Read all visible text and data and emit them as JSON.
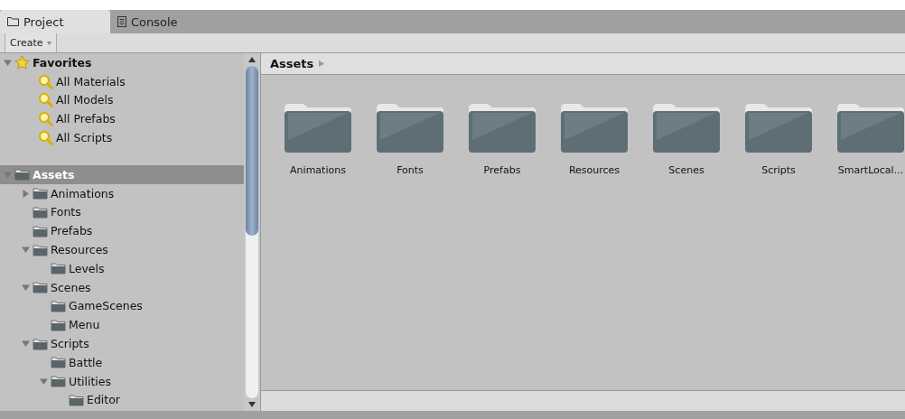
{
  "tabs": [
    {
      "label": "Project",
      "kind": "folder",
      "selected": true
    },
    {
      "label": "Console",
      "kind": "console",
      "selected": false
    }
  ],
  "toolbar": {
    "create_button": "Create"
  },
  "favorites": {
    "label": "Favorites",
    "expanded": true,
    "items": [
      {
        "label": "All Materials"
      },
      {
        "label": "All Models"
      },
      {
        "label": "All Prefabs"
      },
      {
        "label": "All Scripts"
      }
    ]
  },
  "tree": [
    {
      "label": "Assets",
      "expanded": true,
      "selected": true,
      "children": [
        {
          "label": "Animations",
          "expanded": false,
          "selected": false
        },
        {
          "label": "Fonts",
          "selected": false
        },
        {
          "label": "Prefabs",
          "selected": false
        },
        {
          "label": "Resources",
          "expanded": true,
          "selected": false,
          "children": [
            {
              "label": "Levels",
              "selected": false
            }
          ]
        },
        {
          "label": "Scenes",
          "expanded": true,
          "selected": false,
          "children": [
            {
              "label": "GameScenes",
              "selected": false
            },
            {
              "label": "Menu",
              "selected": false
            }
          ]
        },
        {
          "label": "Scripts",
          "expanded": true,
          "selected": false,
          "children": [
            {
              "label": "Battle",
              "selected": false
            },
            {
              "label": "Utilities",
              "expanded": true,
              "selected": false,
              "children": [
                {
                  "label": "Editor",
                  "selected": false
                }
              ]
            }
          ]
        }
      ]
    }
  ],
  "breadcrumb": [
    "Assets"
  ],
  "grid_items": [
    {
      "label": "Animations"
    },
    {
      "label": "Fonts"
    },
    {
      "label": "Prefabs"
    },
    {
      "label": "Resources"
    },
    {
      "label": "Scenes"
    },
    {
      "label": "Scripts"
    },
    {
      "label": "SmartLocal..."
    }
  ]
}
